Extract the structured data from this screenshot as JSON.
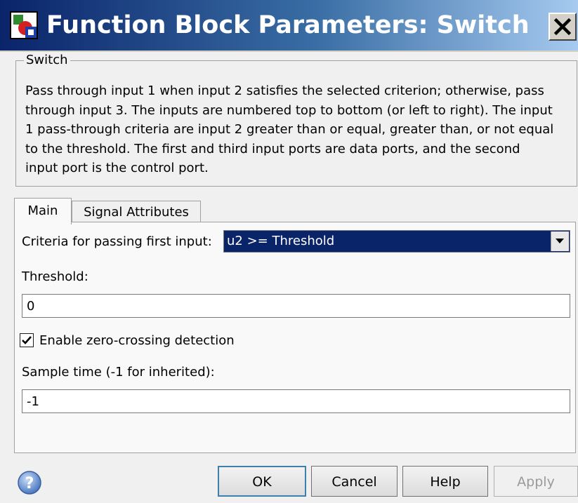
{
  "window": {
    "title": "Function Block Parameters: Switch",
    "close_icon": "close-icon"
  },
  "description": {
    "group_label": "Switch",
    "lines": [
      "Pass through input 1 when input 2 satisfies the selected criterion; otherwise, pass",
      "through input 3.  The inputs are numbered top to bottom (or left to right). The input",
      "1 pass-through criteria are input 2 greater than or equal, greater than, or not equal",
      "to the threshold.  The first and third input ports are data ports, and the second",
      "input port is the control port."
    ]
  },
  "tabs": [
    {
      "label": "Main",
      "selected": true
    },
    {
      "label": "Signal Attributes",
      "selected": false
    }
  ],
  "main": {
    "criteria_label": "Criteria for passing first input:",
    "criteria_value": "u2 >= Threshold",
    "threshold_label": "Threshold:",
    "threshold_value": "0",
    "zero_crossing_label": "Enable zero-crossing detection",
    "zero_crossing_checked": true,
    "sample_time_label": "Sample time (-1 for inherited):",
    "sample_time_value": "-1"
  },
  "buttons": {
    "ok": "OK",
    "cancel": "Cancel",
    "help": "Help",
    "apply": "Apply"
  },
  "colors": {
    "title_bar": "#0a246a",
    "selection": "#0a246a"
  }
}
